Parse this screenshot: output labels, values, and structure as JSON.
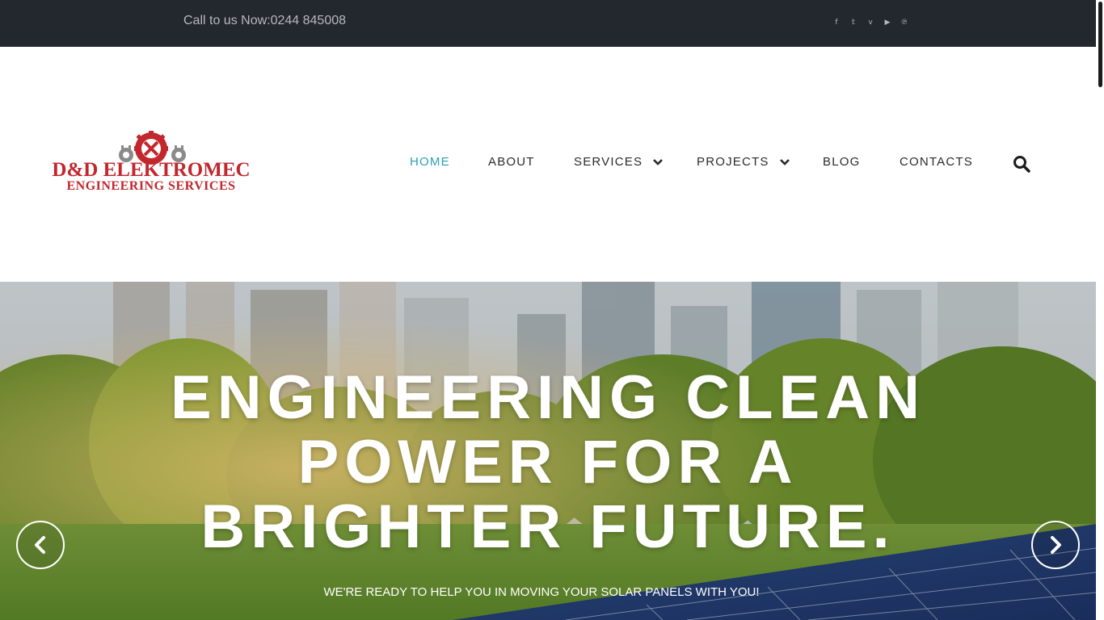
{
  "topbar": {
    "call_text": "Call to us Now:0244 845008",
    "social": [
      {
        "icon": "facebook-icon",
        "glyph": "f"
      },
      {
        "icon": "twitter-icon",
        "glyph": "𝕥"
      },
      {
        "icon": "vimeo-icon",
        "glyph": "v"
      },
      {
        "icon": "youtube-icon",
        "glyph": "▶"
      },
      {
        "icon": "pinterest-icon",
        "glyph": "℗"
      }
    ]
  },
  "header": {
    "logo_line1": "D&D ELEKTROMEC",
    "logo_line2": "ENGINEERING SERVICES",
    "nav": {
      "home": "HOME",
      "about": "ABOUT",
      "services": "SERVICES",
      "projects": "PROJECTS",
      "blog": "BLOG",
      "contacts": "CONTACTS"
    }
  },
  "hero": {
    "title_line1": "ENGINEERING CLEAN",
    "title_line2": "POWER FOR A",
    "title_line3": "BRIGHTER FUTURE.",
    "subtitle": "WE'RE READY TO HELP YOU IN MOVING YOUR SOLAR PANELS WITH YOU!"
  },
  "colors": {
    "topbar_bg": "#23272e",
    "nav_active": "#2c9fb3",
    "logo_red": "#c1272d"
  }
}
